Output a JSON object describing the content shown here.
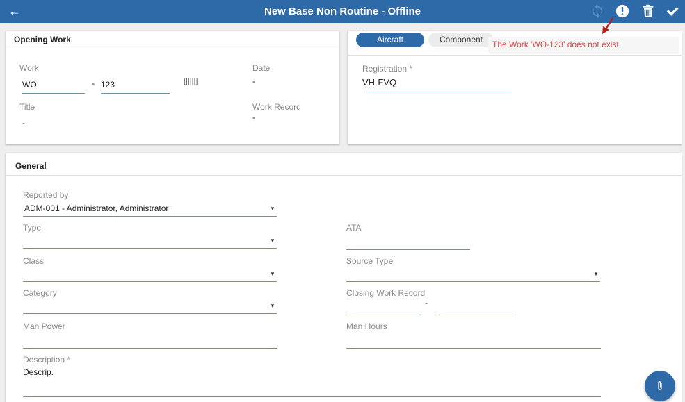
{
  "header": {
    "title": "New Base Non Routine - Offline"
  },
  "icons": {
    "back": "arrow-left-icon",
    "sync": "sync-icon",
    "alert": "alert-icon",
    "delete": "trash-icon",
    "confirm": "check-icon",
    "barcode": "barcode-icon",
    "attach": "paperclip-icon"
  },
  "opening_work": {
    "title": "Opening Work",
    "work_label": "Work",
    "work_prefix": "WO",
    "work_separator": "-",
    "work_number": "123",
    "barcode_glyph": "[|||||]",
    "date_label": "Date",
    "date_value": "-",
    "title_label": "Title",
    "title_value": "-",
    "work_record_label": "Work Record",
    "work_record_value": "-"
  },
  "aircraft_panel": {
    "tab_aircraft": "Aircraft",
    "tab_component": "Component",
    "active_tab": "Aircraft",
    "error_message": "The Work 'WO-123' does not exist.",
    "registration_label": "Registration *",
    "registration_value": "VH-FVQ"
  },
  "general": {
    "title": "General",
    "reported_by_label": "Reported by",
    "reported_by_value": "ADM-001 - Administrator, Administrator",
    "type_label": "Type",
    "type_value": "",
    "ata_label": "ATA",
    "ata_value": "",
    "class_label": "Class",
    "class_value": "",
    "source_type_label": "Source Type",
    "source_type_value": "",
    "category_label": "Category",
    "category_value": "",
    "closing_work_record_label": "Closing Work Record",
    "closing_separator": "-",
    "man_power_label": "Man Power",
    "man_power_value": "",
    "man_hours_label": "Man Hours",
    "man_hours_value": "",
    "description_label": "Description *",
    "description_value": "Descrip."
  },
  "colors": {
    "primary": "#2e6aa8",
    "error": "#e24a4a",
    "arrow": "#b51d1d"
  }
}
